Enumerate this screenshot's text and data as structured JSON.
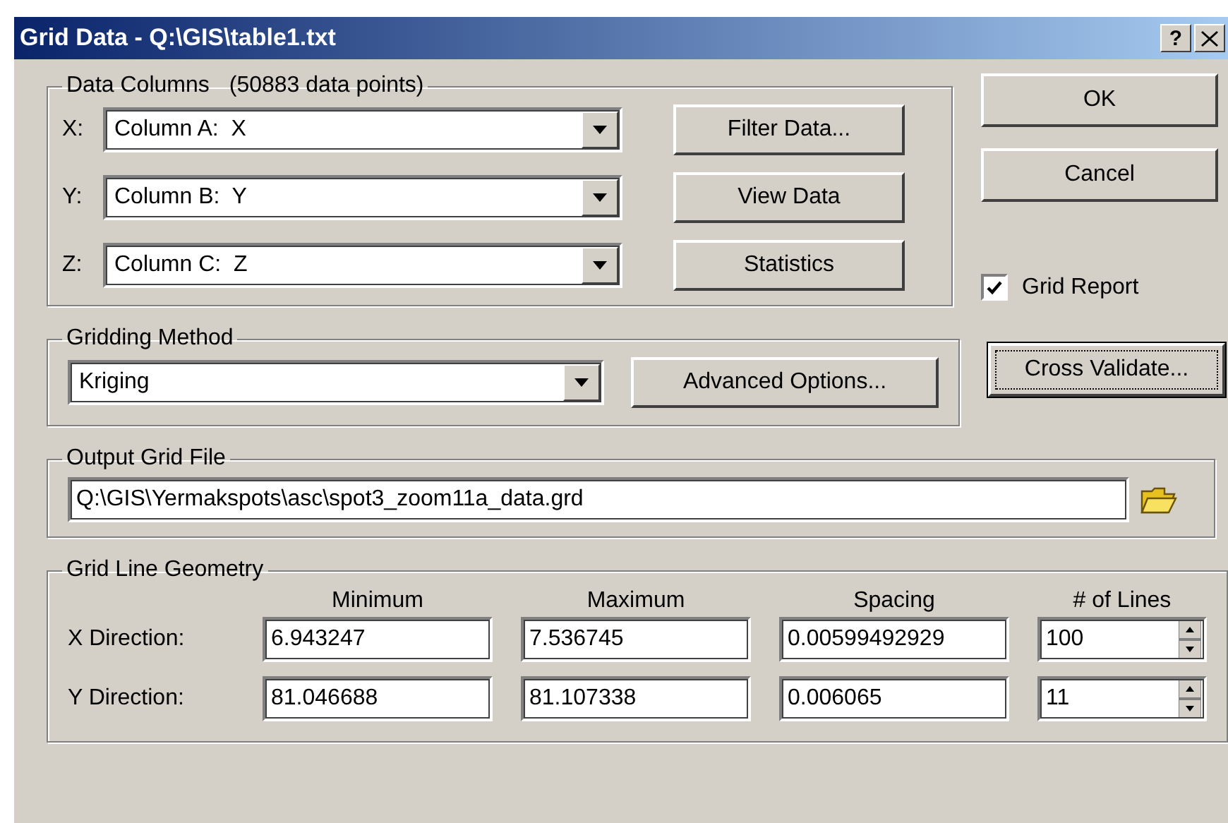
{
  "window": {
    "title": "Grid Data - Q:\\GIS\\table1.txt",
    "help": "?"
  },
  "data_columns": {
    "title": "Data Columns",
    "count": "(50883 data points)",
    "rows": [
      {
        "label": "X:",
        "value": "Column A:  X",
        "button": "Filter Data..."
      },
      {
        "label": "Y:",
        "value": "Column B:  Y",
        "button": "View Data"
      },
      {
        "label": "Z:",
        "value": "Column C:  Z",
        "button": "Statistics"
      }
    ]
  },
  "side_buttons": [
    "OK",
    "Cancel"
  ],
  "grid_report": {
    "label": "Grid Report",
    "checked": true
  },
  "gridding_method": {
    "title": "Gridding Method",
    "value": "Kriging",
    "button": "Advanced Options..."
  },
  "cross_validate": {
    "label": "Cross Validate...",
    "focused": true
  },
  "output_grid_file": {
    "title": "Output Grid File",
    "value": "Q:\\GIS\\Yermakspots\\asc\\spot3_zoom11a_data.grd"
  },
  "grid_line_geometry": {
    "title": "Grid Line Geometry",
    "columns": [
      "Minimum",
      "Maximum",
      "Spacing",
      "# of Lines"
    ],
    "rows": [
      {
        "label": "X Direction:",
        "minimum": "6.943247",
        "maximum": "7.536745",
        "spacing": "0.00599492929",
        "lines": "100"
      },
      {
        "label": "Y Direction:",
        "minimum": "81.046688",
        "maximum": "81.107338",
        "spacing": "0.006065",
        "lines": "11"
      }
    ]
  }
}
